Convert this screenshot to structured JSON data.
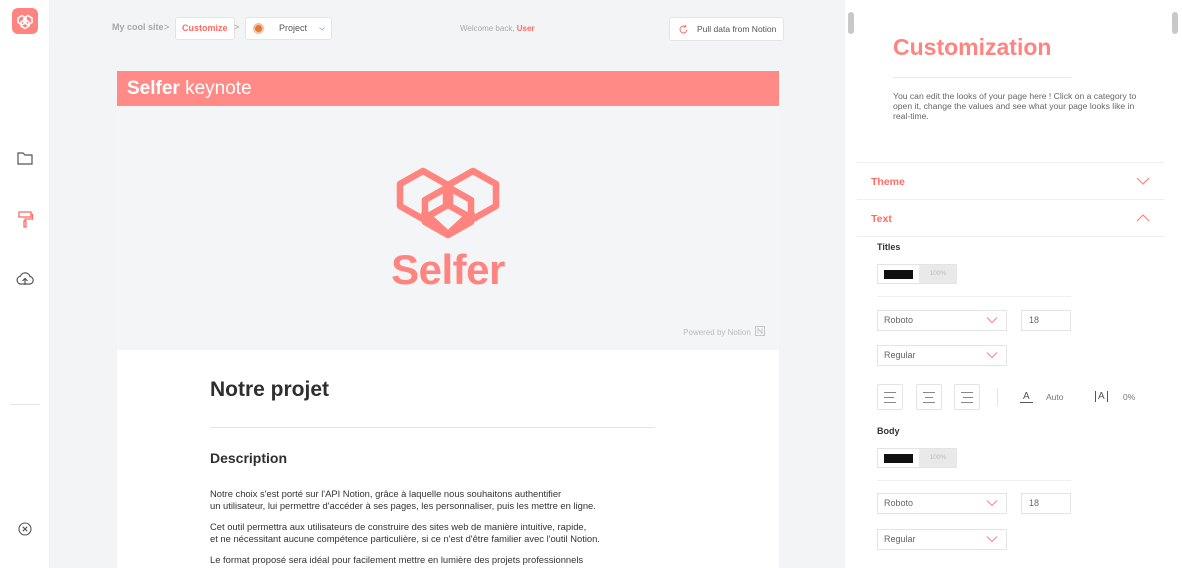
{
  "breadcrumb": {
    "site": "My cool site",
    "current": "Customize",
    "project": "Project",
    "sep": ">"
  },
  "welcome": {
    "prefix": "Welcome back,",
    "user": "User"
  },
  "pull_button": "Pull data from Notion",
  "page": {
    "header_bold": "Selfer",
    "header_light": " keynote",
    "hero_word": "Selfer",
    "powered": "Powered by Notion",
    "title": "Notre projet",
    "section": "Description",
    "paragraphs": [
      [
        "Notre choix s'est porté sur l'API Notion, grâce à laquelle nous souhaitons authentifier",
        "un utilisateur, lui permettre d'accéder à ses pages, les personnaliser, puis les mettre en ligne."
      ],
      [
        "Cet outil permettra aux utilisateurs de construire des sites web de manière intuitive, rapide,",
        " et ne nécessitant aucune compétence particulière, si ce n'est d'être familier avec l'outil Notion."
      ],
      [
        "Le format proposé sera idéal pour facilement mettre en lumière des projets professionnels"
      ]
    ]
  },
  "panel": {
    "title": "Customization",
    "description": "You can edit the looks of your page here ! Click on a category to open it, change the values and see what your page looks like in real-time.",
    "sections": [
      "Theme",
      "Text"
    ],
    "titles": {
      "label": "Titles",
      "color": "#111111",
      "opacity": "100%",
      "font": "Roboto",
      "size": "18",
      "weight": "Regular",
      "line_height": "Auto",
      "letter_spacing": "0%"
    },
    "body": {
      "label": "Body",
      "color": "#111111",
      "opacity": "100%",
      "font": "Roboto",
      "size": "18",
      "weight": "Regular"
    }
  },
  "colors": {
    "accent": "#ff8480",
    "accent_strong": "#ff6b66",
    "header_bar": "#ff8a86"
  },
  "icons": [
    "selfer-logo-icon",
    "folder-icon",
    "paint-roller-icon",
    "cloud-upload-icon",
    "close-circle-icon",
    "refresh-icon",
    "project-avatar-icon",
    "chevron-down-icon",
    "chevron-up-icon",
    "align-left-icon",
    "align-center-icon",
    "align-right-icon",
    "line-height-icon",
    "letter-spacing-icon",
    "notion-icon"
  ]
}
